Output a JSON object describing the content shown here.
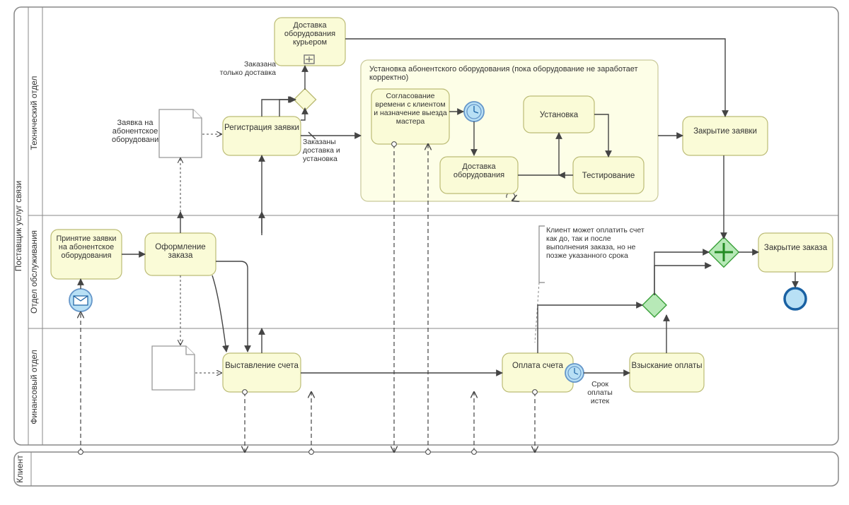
{
  "pools": {
    "provider": "Поставщик услуг связи",
    "client": "Клиент"
  },
  "lanes": {
    "tech": "Технический отдел",
    "service": "Отдел обслуживания",
    "finance": "Финансовый отдел"
  },
  "tasks": {
    "delivery_courier": "Доставка оборудования курьером",
    "registration": "Регистрация заявки",
    "schedule": "Согласование времени с клиентом и назначение выезда мастера",
    "install": "Установка",
    "equipment_delivery": "Доставка оборудования",
    "testing": "Тестирование",
    "close_request": "Закрытие заявки",
    "accept_request": "Принятие заявки на абонентское оборудования",
    "make_order": "Оформление заказа",
    "close_order": "Закрытие заказа",
    "invoice": "Выставление счета",
    "payment": "Оплата счета",
    "collection": "Взыскание оплаты"
  },
  "group": {
    "install_sub": "Установка абонентского оборудования (пока оборудование не заработает корректно)"
  },
  "docs": {
    "request_doc": "Заявка на абонентское оборудование"
  },
  "labels": {
    "only_delivery": "Заказана только доставка",
    "delivery_install": "Заказаны доставка и установка",
    "payment_timer": "Срок оплаты истек"
  },
  "annotation": {
    "payment_note": "Клиент может оплатить счет как до, так и после выполнения заказа, но не позже указанного срока"
  }
}
